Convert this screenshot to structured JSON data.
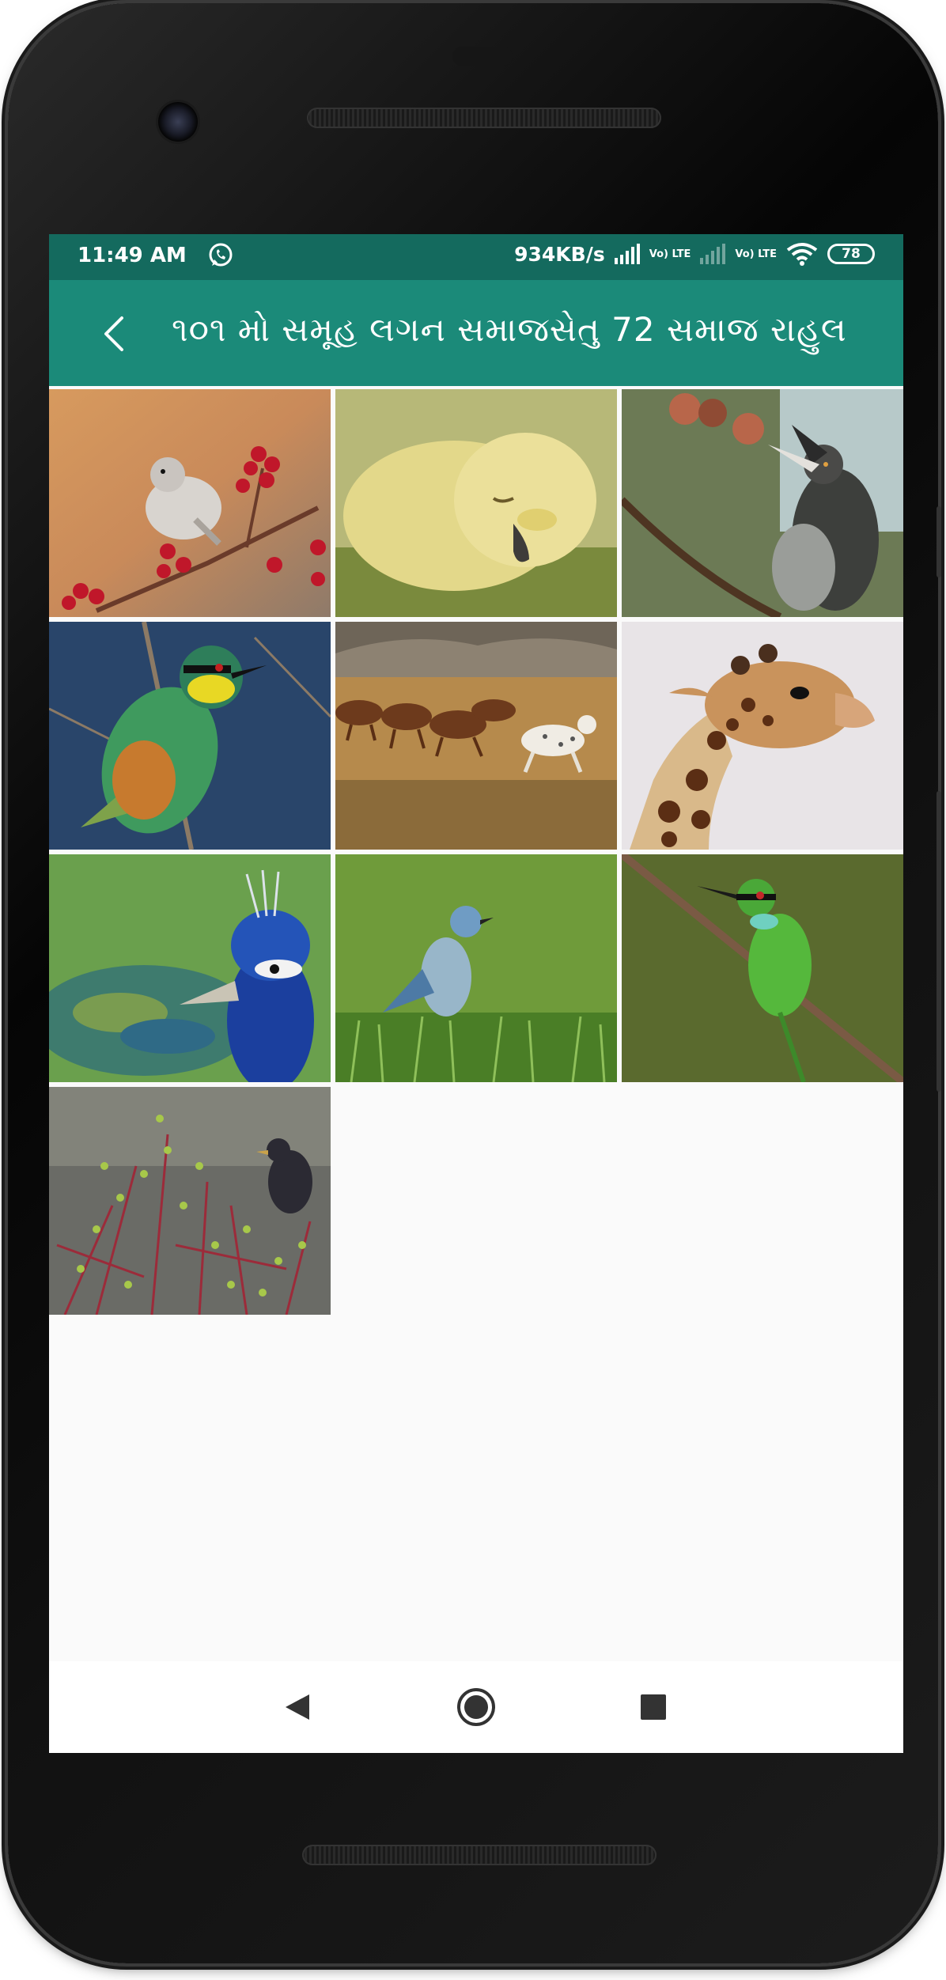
{
  "status_bar": {
    "time": "11:49 AM",
    "network_speed": "934KB/s",
    "volte_1": "Vo) LTE",
    "volte_2": "Vo) LTE",
    "battery": "78"
  },
  "toolbar": {
    "title": "૧૦૧ મો સમૂહ લગન સમાજસેતુ 72 સમાજ રાહુલ"
  },
  "gallery": {
    "images": [
      {
        "name": "image-bird-berries",
        "subject": "bushtit bird on berry branch"
      },
      {
        "name": "image-duckling",
        "subject": "sleeping yellow duckling"
      },
      {
        "name": "image-hornbill",
        "subject": "hornbill on branch"
      },
      {
        "name": "image-bee-eater-colorful",
        "subject": "colorful bee-eater"
      },
      {
        "name": "image-horses",
        "subject": "horses running"
      },
      {
        "name": "image-giraffe",
        "subject": "giraffe head"
      },
      {
        "name": "image-peacock",
        "subject": "peacock"
      },
      {
        "name": "image-bluebird",
        "subject": "mountain bluebird on grass"
      },
      {
        "name": "image-green-bee-eater",
        "subject": "green bee-eater on branch"
      },
      {
        "name": "image-starling",
        "subject": "starling on shrub"
      }
    ]
  },
  "icons": {
    "back": "back-arrow-icon",
    "whatsapp": "whatsapp-icon",
    "wifi": "wifi-icon",
    "signal": "signal-icon",
    "battery": "battery-icon",
    "nav_back": "nav-back-icon",
    "nav_home": "nav-home-icon",
    "nav_recent": "nav-recent-icon"
  },
  "colors": {
    "status_bar": "#146a5e",
    "toolbar": "#1b8a79",
    "background": "#fafafa"
  }
}
